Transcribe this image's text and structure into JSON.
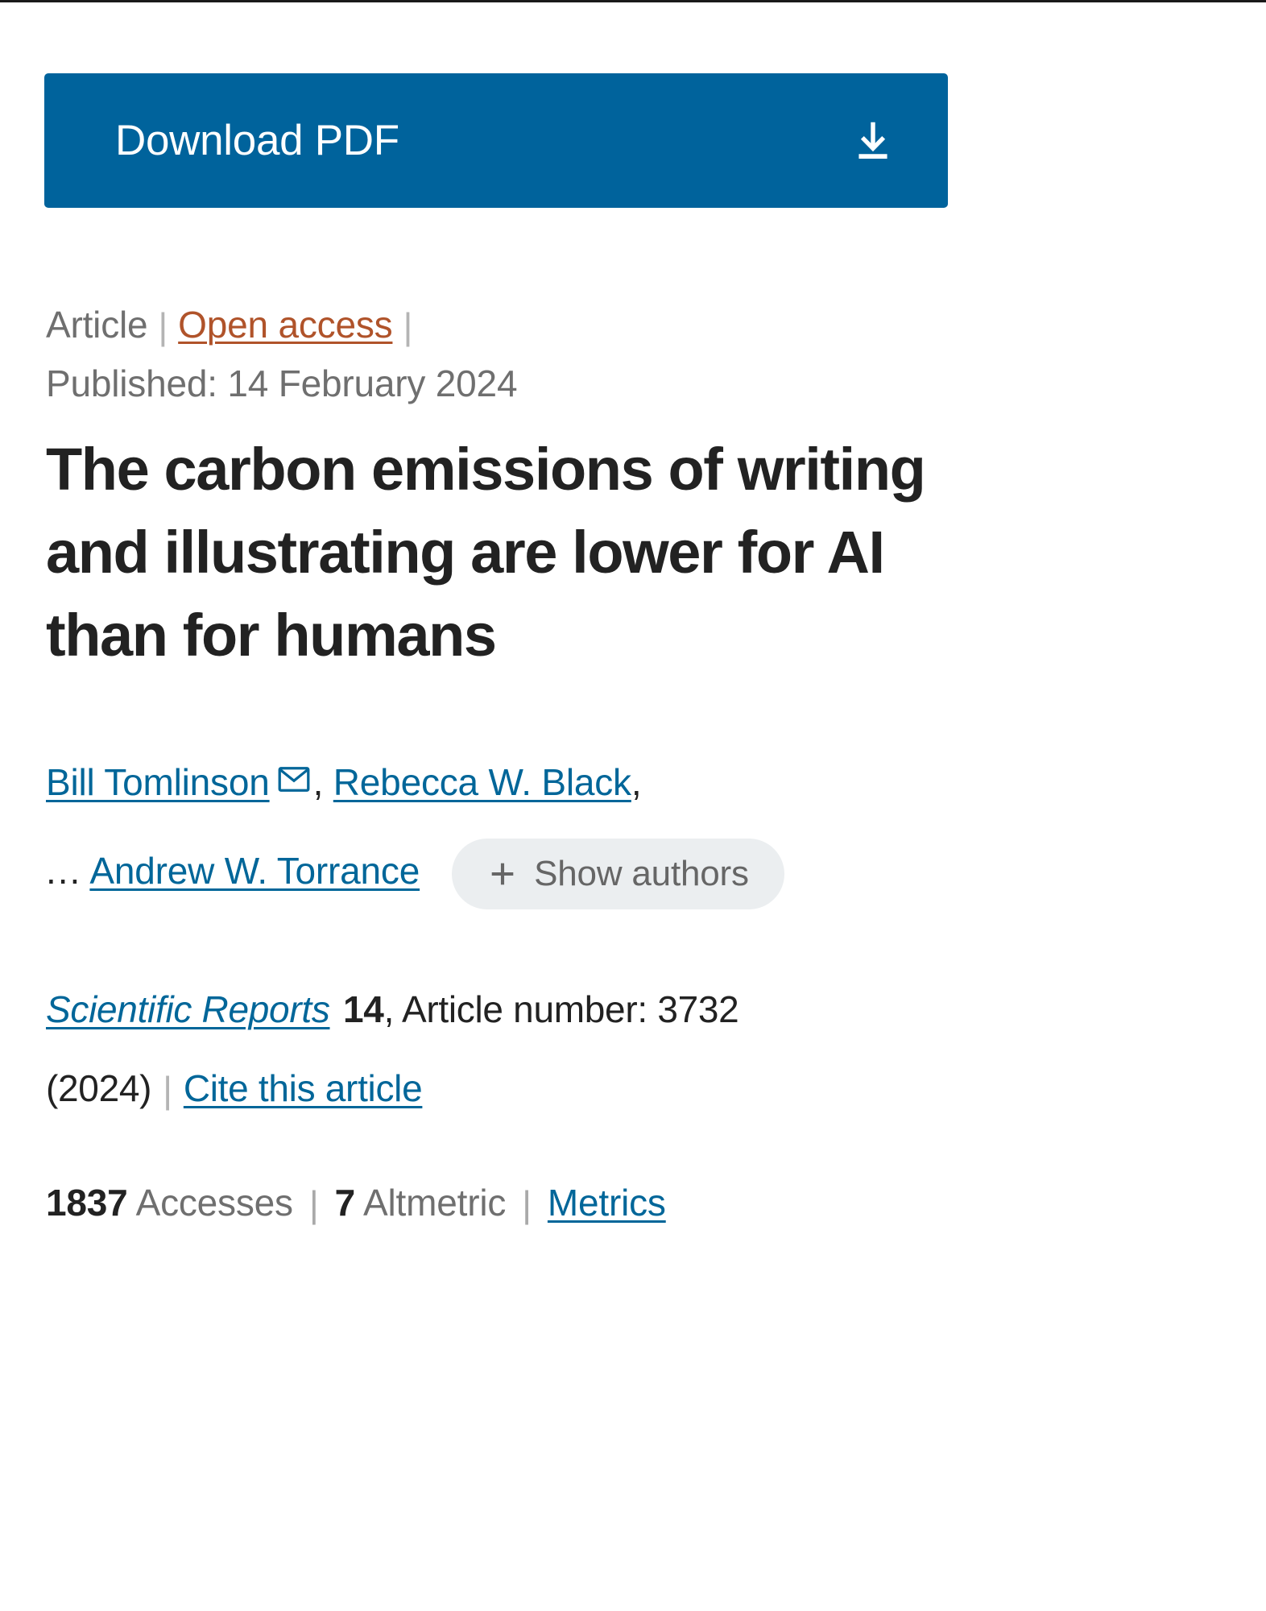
{
  "download": {
    "label": "Download PDF",
    "icon": "download-icon",
    "background_color": "#00639c",
    "text_color": "#ffffff"
  },
  "meta": {
    "type": "Article",
    "separator": "|",
    "access": "Open access",
    "access_color": "#b0532a",
    "published": "Published: 14 February 2024"
  },
  "title": "The carbon emissions of writing and illustrating are lower for AI than for humans",
  "authors": {
    "first": "Bill Tomlinson",
    "mail_icon": "envelope-icon",
    "comma_after_first": ",",
    "second": "Rebecca W. Black",
    "comma_after_second": ",",
    "ellipsis": "...",
    "last": "Andrew W. Torrance",
    "show_authors_label": "Show authors",
    "plus_icon": "plus-icon",
    "link_color": "#006699",
    "pill_background": "#ebeef0"
  },
  "journal": {
    "name": "Scientific Reports",
    "volume": "14",
    "article_number_text": ", Article number: 3732",
    "year": "(2024)",
    "separator": "|",
    "cite_label": "Cite this article"
  },
  "metrics": {
    "accesses_count": "1837",
    "accesses_label": "Accesses",
    "separator": "|",
    "altmetric_count": "7",
    "altmetric_label": "Altmetric",
    "metrics_link": "Metrics"
  }
}
